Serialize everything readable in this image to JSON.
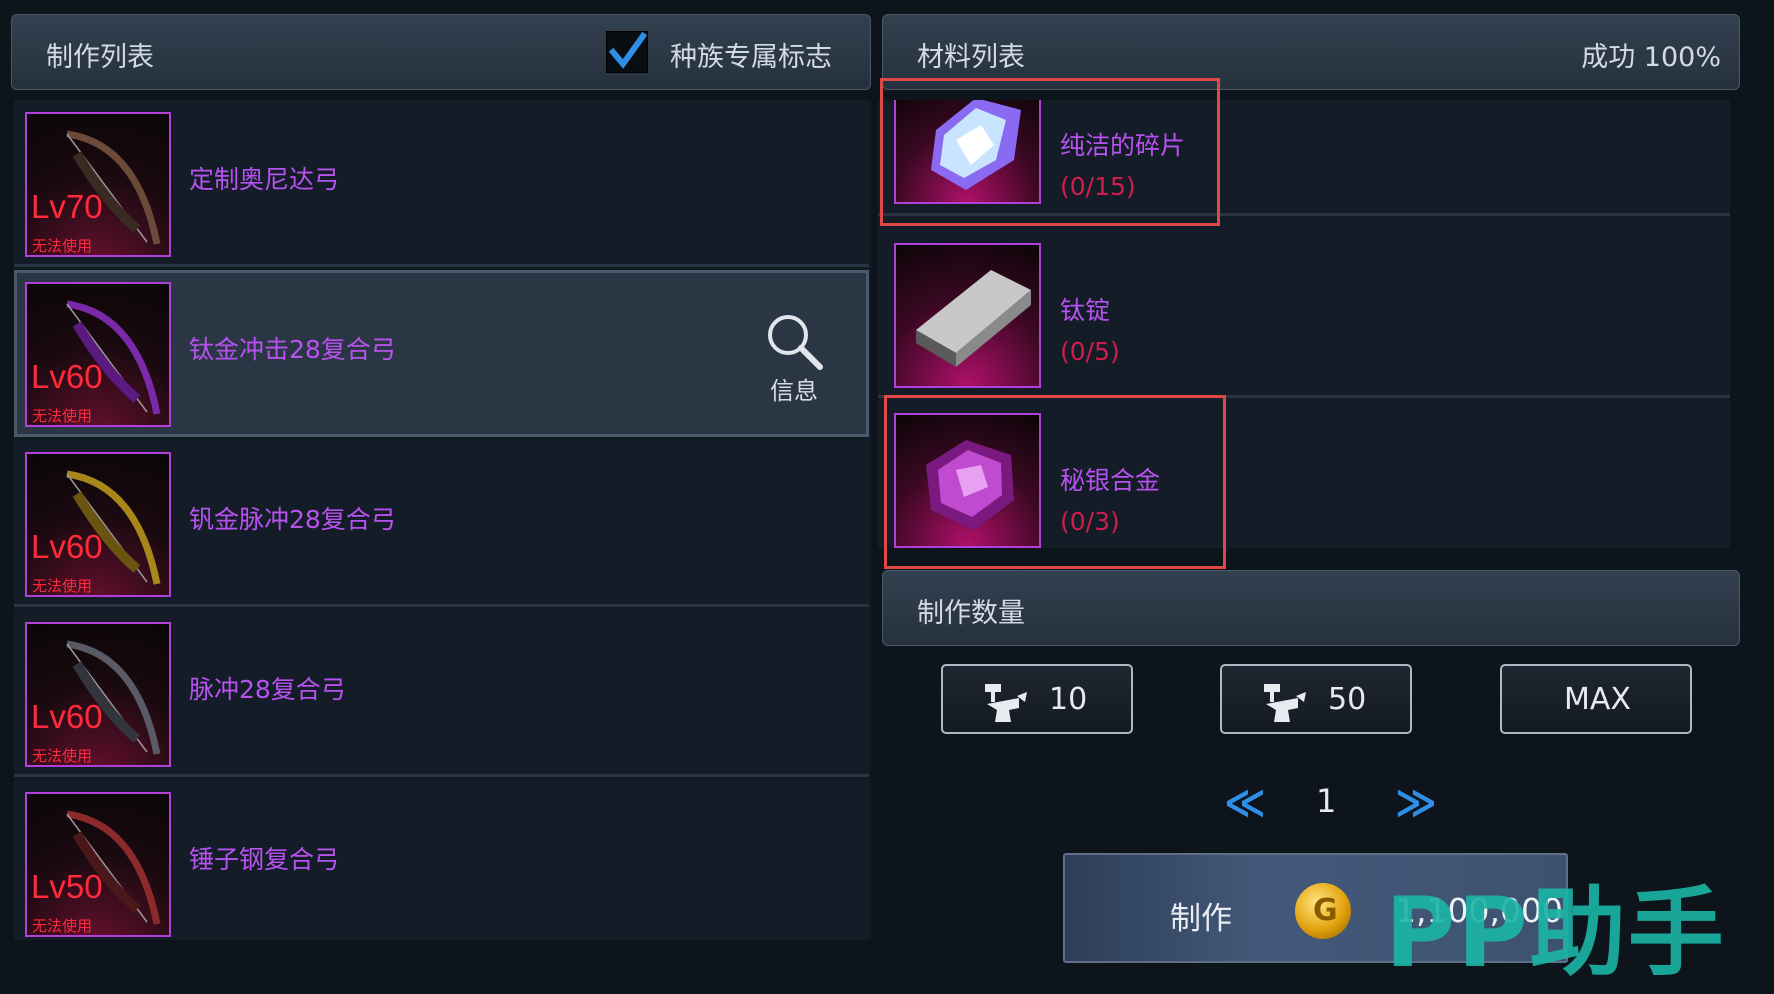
{
  "left_panel": {
    "title": "制作列表",
    "race_flag_label": "种族专属标志",
    "race_flag_checked": true,
    "items": [
      {
        "level": "Lv70",
        "status": "无法使用",
        "name": "定制奥尼达弓",
        "bow_color": "#6b4a3a",
        "selected": false
      },
      {
        "level": "Lv60",
        "status": "无法使用",
        "name": "钛金冲击28复合弓",
        "bow_color": "#7a2aa8",
        "selected": true
      },
      {
        "level": "Lv60",
        "status": "无法使用",
        "name": "钒金脉冲28复合弓",
        "bow_color": "#a8861a",
        "selected": false
      },
      {
        "level": "Lv60",
        "status": "无法使用",
        "name": "脉冲28复合弓",
        "bow_color": "#5a5a66",
        "selected": false
      },
      {
        "level": "Lv50",
        "status": "无法使用",
        "name": "锤子钢复合弓",
        "bow_color": "#8a2a2a",
        "selected": false
      }
    ],
    "info_label": "信息",
    "info_icon": "magnifier-icon"
  },
  "right_panel": {
    "title": "材料列表",
    "success_rate": "成功 100%",
    "materials": [
      {
        "name": "纯洁的碎片",
        "count": "(0/15)",
        "icon": "crystal-shard-icon",
        "highlighted": true
      },
      {
        "name": "钛锭",
        "count": "(0/5)",
        "icon": "titanium-ingot-icon",
        "highlighted": false
      },
      {
        "name": "秘银合金",
        "count": "(0/3)",
        "icon": "mithril-alloy-icon",
        "highlighted": true
      }
    ]
  },
  "quantity": {
    "title": "制作数量",
    "buttons": [
      {
        "label": "10",
        "icon": "anvil-icon"
      },
      {
        "label": "50",
        "icon": "anvil-icon"
      },
      {
        "label": "MAX",
        "icon": ""
      }
    ],
    "prev": "≪",
    "page": "1",
    "next": "≫"
  },
  "craft": {
    "label": "制作",
    "cost": "1,100,000",
    "coin_icon": "gold-coin-icon",
    "coin_glyph": "G"
  },
  "watermark": "PP助手",
  "colors": {
    "item_name": "#b752f0",
    "count": "#d11c4e",
    "level": "#ff2a3a",
    "highlight_box": "#e04848",
    "accent": "#2f8ee6"
  }
}
